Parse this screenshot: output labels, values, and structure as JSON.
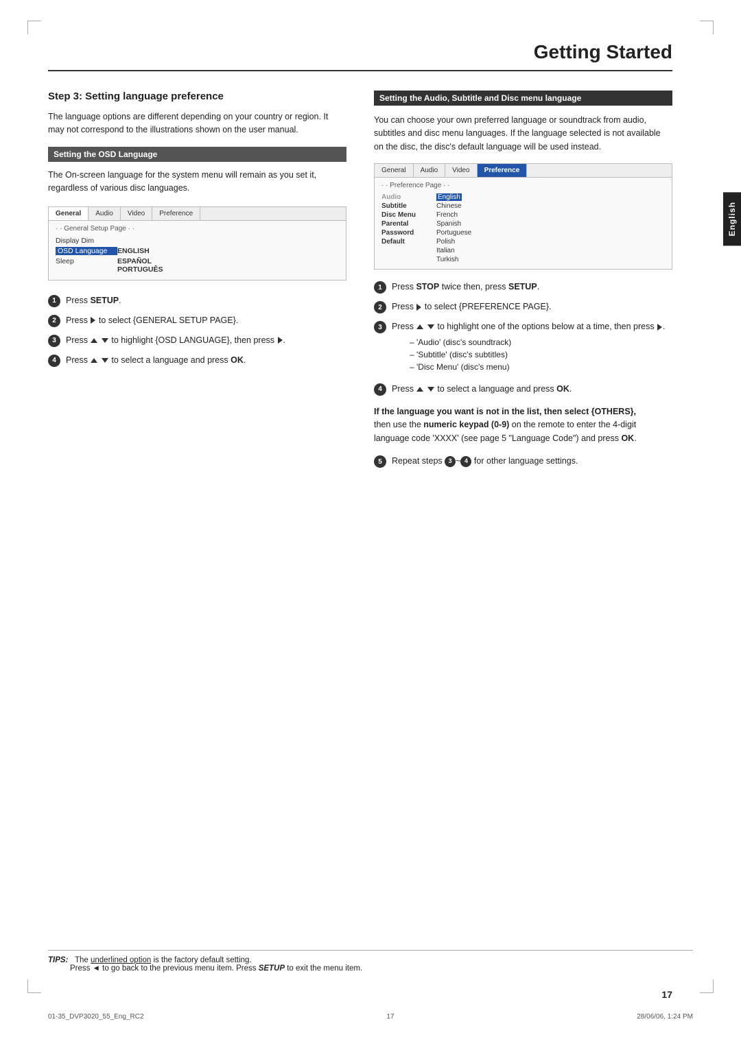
{
  "page": {
    "title": "Getting Started",
    "page_number": "17",
    "english_tab": "English"
  },
  "footer": {
    "left": "01-35_DVP3020_55_Eng_RC2",
    "center": "17",
    "right": "28/06/06, 1:24 PM"
  },
  "tips": {
    "label": "TIPS:",
    "line1": "The underlined option is the factory default setting.",
    "line2": "Press ◄ to go back to the previous menu item. Press SETUP to exit the menu item."
  },
  "left_section": {
    "heading": "Step 3: Setting language preference",
    "intro": "The language options are different depending on your country or region. It may not correspond to the illustrations shown on the user manual.",
    "osd_heading": "Setting the OSD Language",
    "osd_text": "The On-screen language for the system menu will remain as you set it, regardless of various disc languages.",
    "menu": {
      "tabs": [
        "General",
        "Audio",
        "Video",
        "Preference"
      ],
      "active_tab": "General",
      "page_label": "· · General Setup Page · ·",
      "rows": [
        {
          "label": "Display Dim",
          "value": ""
        },
        {
          "label": "OSD Language",
          "value": "ENGLISH",
          "label_highlight": true
        },
        {
          "label": "Sleep",
          "value": "ESPAÑOL\nPORTUGUÊS",
          "bold": true
        }
      ]
    },
    "steps": [
      {
        "num": "1",
        "text": "Press <b>SETUP</b>."
      },
      {
        "num": "2",
        "text": "Press ▶ to select {GENERAL SETUP PAGE}."
      },
      {
        "num": "3",
        "text": "Press ▲ ▼ to highlight {OSD LANGUAGE}, then press ▶."
      },
      {
        "num": "4",
        "text": "Press ▲ ▼ to select a language and press <b>OK</b>."
      }
    ]
  },
  "right_section": {
    "heading": "Setting the Audio, Subtitle and Disc menu language",
    "intro": "You can choose your own preferred language or soundtrack from audio, subtitles and disc menu languages. If the language selected is not available on the disc, the disc's default language will be used instead.",
    "menu": {
      "tabs": [
        "General",
        "Audio",
        "Video",
        "Preference"
      ],
      "active_tab": "Preference",
      "page_label": "· · Preference Page · ·",
      "rows": [
        {
          "label": "Audio",
          "value": "English",
          "label_dim": false,
          "value_highlight": true
        },
        {
          "label": "Subtitle",
          "value": "Chinese"
        },
        {
          "label": "Disc Menu",
          "value": "French"
        },
        {
          "label": "Parental",
          "value": "Spanish"
        },
        {
          "label": "Password",
          "value": "Portuguese"
        },
        {
          "label": "Default",
          "value": "Polish"
        },
        {
          "label": "",
          "value": "Italian"
        },
        {
          "label": "",
          "value": "Turkish"
        }
      ]
    },
    "steps": [
      {
        "num": "1",
        "text": "Press <b>STOP</b> twice then, press <b>SETUP</b>."
      },
      {
        "num": "2",
        "text": "Press ▶ to select {PREFERENCE PAGE}."
      },
      {
        "num": "3",
        "text": "Press ▲ ▼ to highlight one of the options below at a time, then press ▶.",
        "bullets": [
          "– 'Audio' (disc's soundtrack)",
          "– 'Subtitle' (disc's subtitles)",
          "– 'Disc Menu' (disc's menu)"
        ]
      },
      {
        "num": "4",
        "text": "Press ▲ ▼ to select a language and press <b>OK</b>."
      }
    ],
    "info_heading": "If the language you want is not in the list, then select {OTHERS},",
    "info_body": "then use the <b>numeric keypad (0-9)</b> on the remote to enter the 4-digit language code 'XXXX' (see page 5 \"Language Code\") and press <b>OK</b>.",
    "step5": "Repeat steps ③~④ for other language settings."
  }
}
